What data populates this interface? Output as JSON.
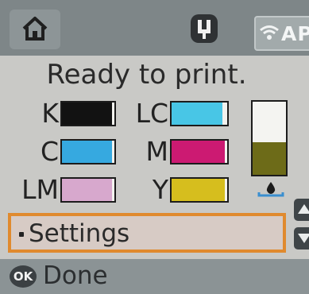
{
  "top_bar": {
    "home_icon": "home-icon",
    "bluetooth_icon": "bluetooth-icon",
    "wifi_icon": "wifi-icon",
    "wifi_label": "AP"
  },
  "status": "Ready to print.",
  "inks": [
    {
      "label": "K",
      "color": "#121212",
      "level": 0.95
    },
    {
      "label": "LC",
      "color": "#48c6e6",
      "level": 0.92
    },
    {
      "label": "C",
      "color": "#36a9e0",
      "level": 0.95
    },
    {
      "label": "M",
      "color": "#cc1a72",
      "level": 0.95
    },
    {
      "label": "LM",
      "color": "#d7a8cd",
      "level": 0.95
    },
    {
      "label": "Y",
      "color": "#d6be1e",
      "level": 0.95
    }
  ],
  "maintenance_box": {
    "icon": "ink-drop-icon",
    "color": "#6d6b18",
    "level": 0.45
  },
  "menu": {
    "selected_item": "Settings"
  },
  "bottom_bar": {
    "ok_icon": "ok-button-icon",
    "ok_text": "OK",
    "done_label": "Done"
  },
  "colors": {
    "highlight_border": "#e08a2e",
    "top_bar": "#7e8688"
  }
}
